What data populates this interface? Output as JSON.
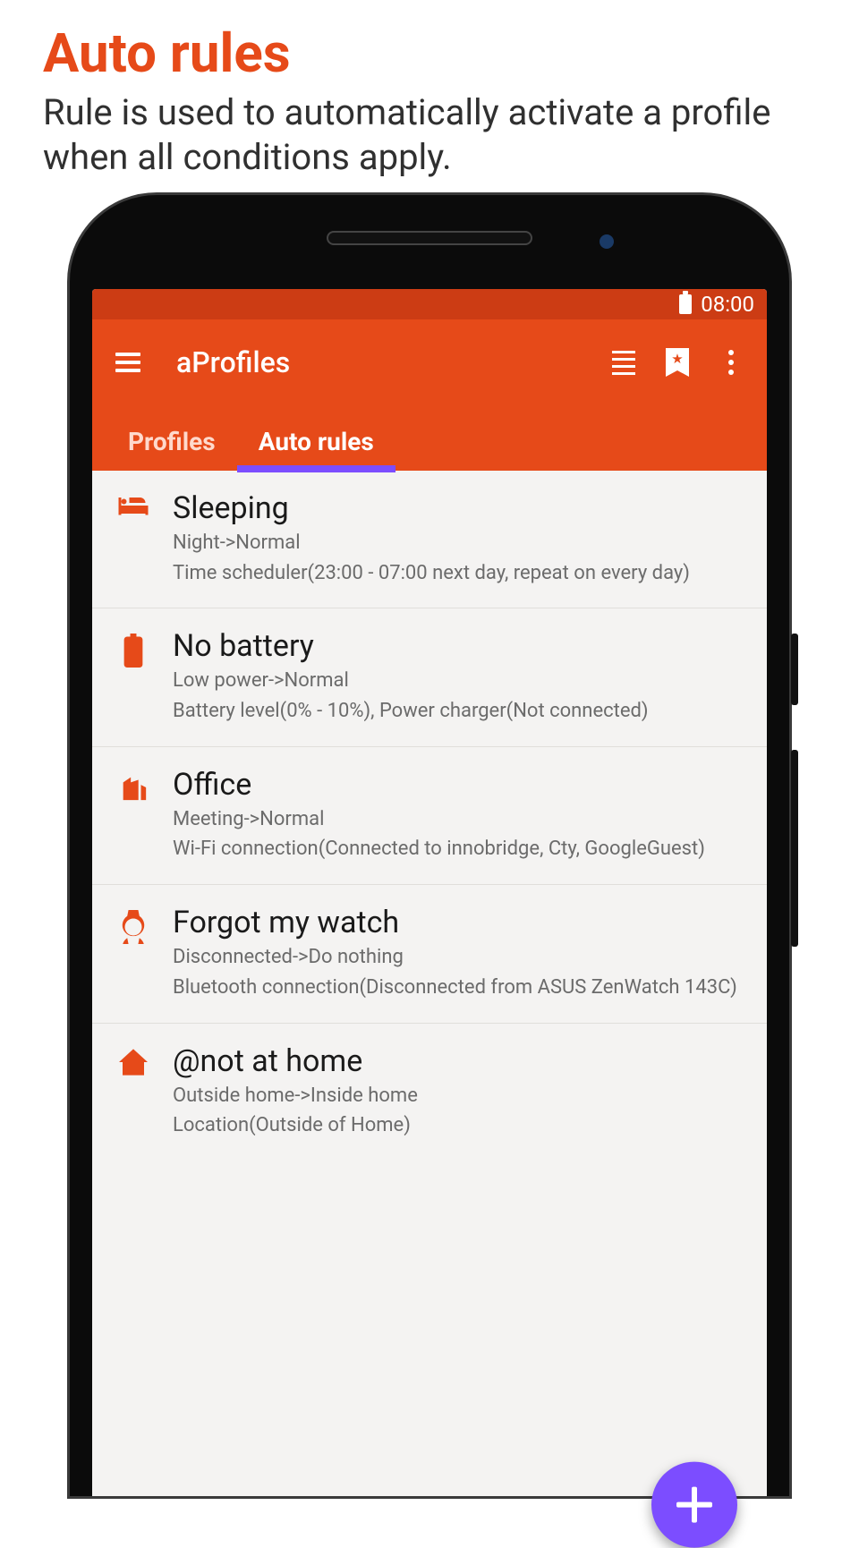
{
  "promo": {
    "title": "Auto rules",
    "subtitle": "Rule is used to automatically activate a profile when all conditions apply."
  },
  "statusbar": {
    "time": "08:00"
  },
  "appbar": {
    "title": "aProfiles"
  },
  "tabs": [
    {
      "label": "Profiles",
      "active": false
    },
    {
      "label": "Auto rules",
      "active": true
    }
  ],
  "rules": [
    {
      "icon": "bed-icon",
      "title": "Sleeping",
      "transition": "Night->Normal",
      "detail": "Time scheduler(23:00 - 07:00 next day, repeat on every day)"
    },
    {
      "icon": "battery-alert-icon",
      "title": "No battery",
      "transition": "Low power->Normal",
      "detail": "Battery level(0% - 10%), Power charger(Not connected)"
    },
    {
      "icon": "building-icon",
      "title": "Office",
      "transition": "Meeting->Normal",
      "detail": "Wi-Fi connection(Connected to innobridge, Cty, GoogleGuest)"
    },
    {
      "icon": "watch-icon",
      "title": "Forgot my watch",
      "transition": "Disconnected->Do nothing",
      "detail": "Bluetooth connection(Disconnected from ASUS ZenWatch 143C)"
    },
    {
      "icon": "home-icon",
      "title": "@not at home",
      "transition": "Outside home->Inside home",
      "detail": "Location(Outside of Home)"
    }
  ]
}
